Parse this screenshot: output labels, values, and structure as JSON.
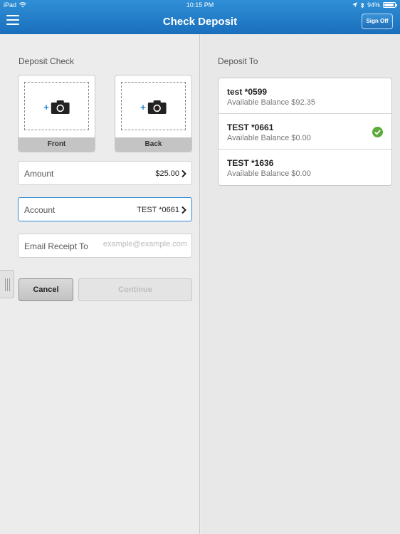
{
  "status_bar": {
    "device": "iPad",
    "time": "10:15 PM",
    "battery": "94%",
    "battery_level": 0.94
  },
  "nav": {
    "title": "Check Deposit",
    "signoff_label": "Sign Off"
  },
  "deposit_check": {
    "section_label": "Deposit Check",
    "front_label": "Front",
    "back_label": "Back",
    "amount": {
      "label": "Amount",
      "value": "$25.00"
    },
    "account": {
      "label": "Account",
      "value": "TEST *0661"
    },
    "email": {
      "label": "Email Receipt To",
      "value": "",
      "placeholder": "example@example.com"
    },
    "cancel_label": "Cancel",
    "continue_label": "Continue"
  },
  "deposit_to": {
    "section_label": "Deposit To",
    "accounts": [
      {
        "name": "test *0599",
        "balance": "Available Balance $92.35",
        "selected": false
      },
      {
        "name": "TEST *0661",
        "balance": "Available Balance $0.00",
        "selected": true
      },
      {
        "name": "TEST *1636",
        "balance": "Available Balance $0.00",
        "selected": false
      }
    ]
  },
  "colors": {
    "nav_top": "#2f8fd6",
    "nav_bottom": "#1a6fbd",
    "accent": "#2a8ad8",
    "check_green": "#5aab3a"
  }
}
